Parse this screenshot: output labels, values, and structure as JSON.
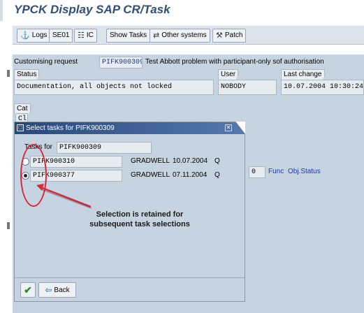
{
  "window": {
    "title": "YPCK Display SAP CR/Task"
  },
  "toolbar": {
    "items": [
      {
        "label": "Logs",
        "icon": "logs-icon"
      },
      {
        "label": "SE01",
        "icon": ""
      },
      {
        "label": "IC",
        "icon": "ic-icon"
      },
      {
        "label": "Show Tasks",
        "icon": ""
      },
      {
        "label": "Other systems",
        "icon": "other-systems-icon"
      },
      {
        "label": "Patch",
        "icon": "patch-icon"
      }
    ]
  },
  "request": {
    "label": "Customising request",
    "id": "PIFK900309",
    "description": "Test Abbott problem with participant-only sof authorisation"
  },
  "status_section": {
    "status_label": "Status",
    "status_value": "Documentation, all objects not locked",
    "user_label": "User",
    "user_value": "NOBODY",
    "last_change_label": "Last change",
    "last_change_value": "10.07.2004 10:30:24"
  },
  "background_fragments": {
    "cat_label": "Cat",
    "cl_label": "Cl",
    "number_value": "0",
    "func_label": "Func",
    "obj_status_label": "Obj.Status"
  },
  "dialog": {
    "title": "Select tasks for PIFK900309",
    "tasks_for_label": "Tasks for",
    "tasks_for_value": "PIFK900309",
    "tasks": [
      {
        "id": "PIFK900310",
        "user": "GRADWELL",
        "date": "10.07.2004",
        "type": "Q",
        "selected": false
      },
      {
        "id": "PIFK900377",
        "user": "GRADWELL",
        "date": "07.11.2004",
        "type": "Q",
        "selected": true
      }
    ],
    "back_label": "Back"
  },
  "annotation": {
    "text_line1": "Selection is retained for",
    "text_line2": "subsequent task selections",
    "color": "#d8283a"
  }
}
